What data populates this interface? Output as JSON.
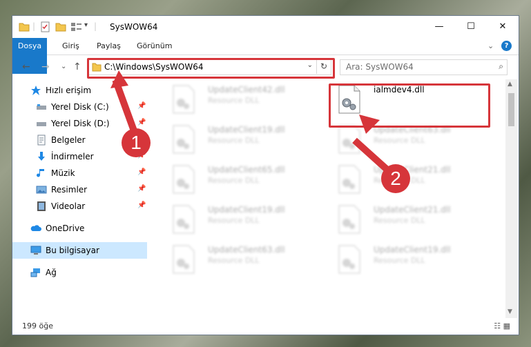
{
  "window": {
    "title": "SysWOW64",
    "controls": {
      "minimize": "—",
      "maximize": "☐",
      "close": "✕"
    }
  },
  "ribbon": {
    "tabs": [
      "Dosya",
      "Giriş",
      "Paylaş",
      "Görünüm"
    ],
    "help": "?",
    "collapse": "⌄"
  },
  "nav": {
    "back": "←",
    "forward": "→",
    "recent": "⌄",
    "up": "↑",
    "address": "C:\\Windows\\SysWOW64",
    "address_dropdown": "⌄",
    "refresh": "↻",
    "search_placeholder": "Ara: SysWOW64",
    "search_icon": "⌕"
  },
  "sidebar": {
    "items": [
      {
        "label": "Hızlı erişim",
        "icon": "star-icon",
        "pinned": false
      },
      {
        "label": "Yerel Disk (C:)",
        "icon": "drive-icon",
        "pinned": true
      },
      {
        "label": "Yerel Disk (D:)",
        "icon": "drive-icon",
        "pinned": true
      },
      {
        "label": "Belgeler",
        "icon": "document-icon",
        "pinned": true
      },
      {
        "label": "İndirmeler",
        "icon": "download-icon",
        "pinned": true
      },
      {
        "label": "Müzik",
        "icon": "music-icon",
        "pinned": true
      },
      {
        "label": "Resimler",
        "icon": "pictures-icon",
        "pinned": true
      },
      {
        "label": "Videolar",
        "icon": "video-icon",
        "pinned": true
      },
      {
        "label": "OneDrive",
        "icon": "cloud-icon",
        "pinned": false
      },
      {
        "label": "Bu bilgisayar",
        "icon": "computer-icon",
        "pinned": false
      },
      {
        "label": "Ağ",
        "icon": "network-icon",
        "pinned": false
      }
    ],
    "pin_glyph": "📌"
  },
  "files": [
    {
      "name": "UpdateClient42.dll",
      "type": "Resource DLL"
    },
    {
      "name": "ialmdev4.dll",
      "type": ""
    },
    {
      "name": "UpdateClient19.dll",
      "type": "Resource DLL"
    },
    {
      "name": "UpdateClient63.dll",
      "type": "Resource DLL"
    },
    {
      "name": "UpdateClient65.dll",
      "type": "Resource DLL"
    },
    {
      "name": "UpdateClient21.dll",
      "type": "Resource DLL"
    },
    {
      "name": "UpdateClient19.dll",
      "type": "Resource DLL"
    },
    {
      "name": "UpdateClient21.dll",
      "type": "Resource DLL"
    },
    {
      "name": "UpdateClient63.dll",
      "type": "Resource DLL"
    },
    {
      "name": "UpdateClient19.dll",
      "type": "Resource DLL"
    }
  ],
  "status": {
    "count": "199 öğe",
    "views": "☷ ▦"
  },
  "annotations": {
    "marker1": "1",
    "marker2": "2",
    "color": "#d6353a"
  },
  "colors": {
    "file_tab": "#1979ca",
    "selected": "#cce8ff"
  }
}
